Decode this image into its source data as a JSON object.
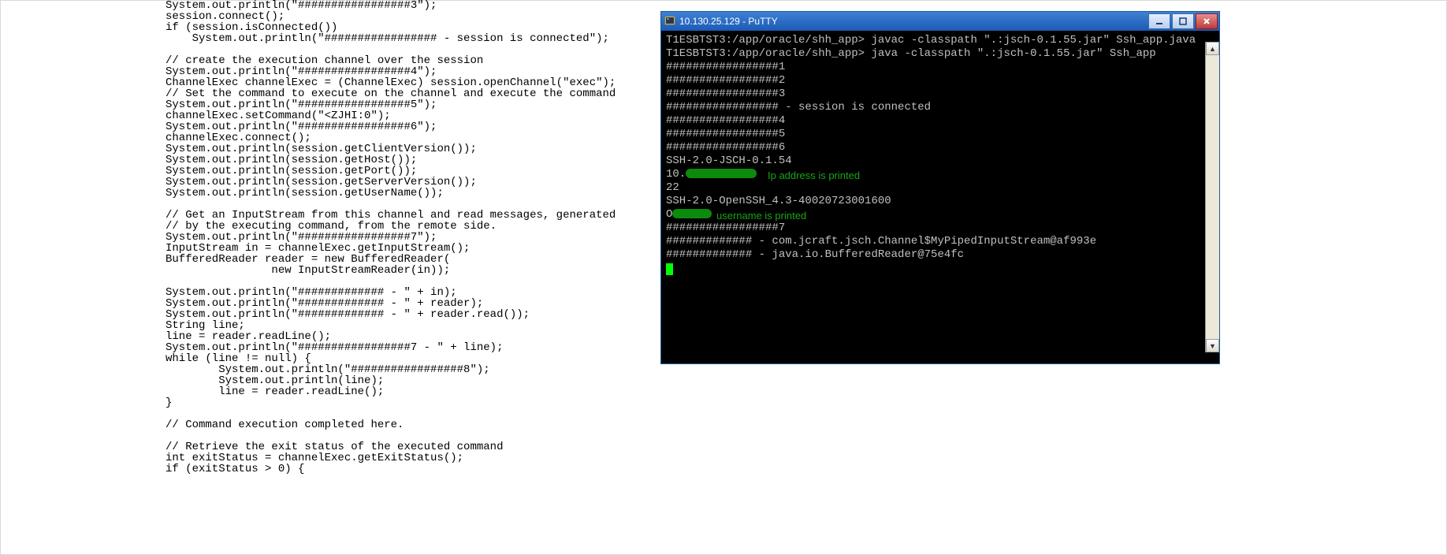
{
  "code": {
    "lines": [
      "System.out.println(\"#################3\");",
      "session.connect();",
      "if (session.isConnected())",
      "    System.out.println(\"################# - session is connected\");",
      "",
      "// create the execution channel over the session",
      "System.out.println(\"#################4\");",
      "ChannelExec channelExec = (ChannelExec) session.openChannel(\"exec\");",
      "// Set the command to execute on the channel and execute the command",
      "System.out.println(\"#################5\");",
      "channelExec.setCommand(\"<ZJHI:0\");",
      "System.out.println(\"#################6\");",
      "channelExec.connect();",
      "System.out.println(session.getClientVersion());",
      "System.out.println(session.getHost());",
      "System.out.println(session.getPort());",
      "System.out.println(session.getServerVersion());",
      "System.out.println(session.getUserName());",
      "",
      "// Get an InputStream from this channel and read messages, generated",
      "// by the executing command, from the remote side.",
      "System.out.println(\"#################7\");",
      "InputStream in = channelExec.getInputStream();",
      "BufferedReader reader = new BufferedReader(",
      "                new InputStreamReader(in));",
      "",
      "System.out.println(\"############# - \" + in);",
      "System.out.println(\"############# - \" + reader);",
      "System.out.println(\"############# - \" + reader.read());",
      "String line;",
      "line = reader.readLine();",
      "System.out.println(\"#################7 - \" + line);",
      "while (line != null) {",
      "        System.out.println(\"#################8\");",
      "        System.out.println(line);",
      "        line = reader.readLine();",
      "}",
      "",
      "// Command execution completed here.",
      "",
      "// Retrieve the exit status of the executed command",
      "int exitStatus = channelExec.getExitStatus();",
      "if (exitStatus > 0) {"
    ]
  },
  "putty": {
    "title": "10.130.25.129 - PuTTY",
    "terminal_lines": [
      "T1ESBTST3:/app/oracle/shh_app> javac -classpath \".:jsch-0.1.55.jar\" Ssh_app.java",
      "T1ESBTST3:/app/oracle/shh_app> java -classpath \".:jsch-0.1.55.jar\" Ssh_app",
      "#################1",
      "#################2",
      "#################3",
      "################# - session is connected",
      "#################4",
      "#################5",
      "#################6",
      "SSH-2.0-JSCH-0.1.54",
      "10.",
      "22",
      "SSH-2.0-OpenSSH_4.3-40020723001600",
      "O",
      "#################7",
      "############# - com.jcraft.jsch.Channel$MyPipedInputStream@af993e",
      "############# - java.io.BufferedReader@75e4fc"
    ],
    "annotation_ip": "Ip address is printed",
    "annotation_user": "username is printed"
  }
}
